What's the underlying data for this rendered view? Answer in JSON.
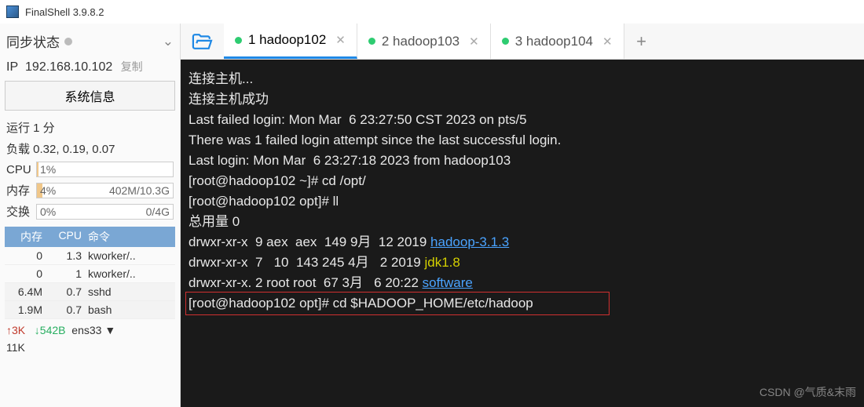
{
  "app": {
    "title": "FinalShell 3.9.8.2"
  },
  "sidebar": {
    "sync_label": "同步状态",
    "ip_label": "IP",
    "ip": "192.168.10.102",
    "copy": "复制",
    "sysinfo_btn": "系统信息",
    "uptime": "运行 1 分",
    "load": "负载 0.32, 0.19, 0.07",
    "cpu": {
      "lbl": "CPU",
      "pct": "1%",
      "w": "1%"
    },
    "mem": {
      "lbl": "内存",
      "pct": "4%",
      "val": "402M/10.3G",
      "w": "4%"
    },
    "swap": {
      "lbl": "交换",
      "pct": "0%",
      "val": "0/4G",
      "w": "0%"
    },
    "phead": {
      "mem": "内存",
      "cpu": "CPU",
      "cmd": "命令"
    },
    "procs": [
      {
        "mem": "0",
        "cpu": "1.3",
        "cmd": "kworker/.."
      },
      {
        "mem": "0",
        "cpu": "1",
        "cmd": "kworker/.."
      },
      {
        "mem": "6.4M",
        "cpu": "0.7",
        "cmd": "sshd"
      },
      {
        "mem": "1.9M",
        "cpu": "0.7",
        "cmd": "bash"
      }
    ],
    "net": {
      "up": "↑3K",
      "down": "↓542B",
      "iface": "ens33 ▼",
      "extra": "11K"
    }
  },
  "tabs": [
    {
      "label": "1 hadoop102",
      "active": true
    },
    {
      "label": "2 hadoop103",
      "active": false
    },
    {
      "label": "3 hadoop104",
      "active": false
    }
  ],
  "term": {
    "l1": "连接主机...",
    "l2": "连接主机成功",
    "l3": "Last failed login: Mon Mar  6 23:27:50 CST 2023 on pts/5",
    "l4": "There was 1 failed login attempt since the last successful login.",
    "l5": "Last login: Mon Mar  6 23:27:18 2023 from hadoop103",
    "l6": "[root@hadoop102 ~]# cd /opt/",
    "l7": "[root@hadoop102 opt]# ll",
    "l8": "总用量 0",
    "r1a": "drwxr-xr-x  9 aex  aex  149 9月  12 2019 ",
    "r1b": "hadoop-3.1.3",
    "r2a": "drwxr-xr-x  7   10  143 245 4月   2 2019 ",
    "r2b": "jdk1.8",
    "r3a": "drwxr-xr-x. 2 root root  67 3月   6 20:22 ",
    "r3b": "software",
    "l9": "[root@hadoop102 opt]# cd $HADOOP_HOME/etc/hadoop"
  },
  "watermark": "CSDN @气质&末雨"
}
